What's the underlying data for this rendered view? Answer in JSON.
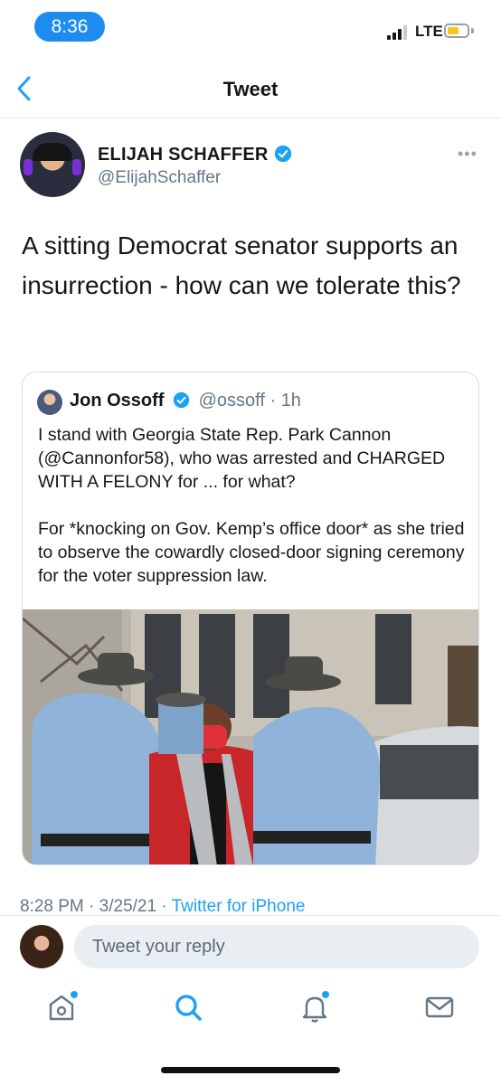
{
  "status_bar": {
    "time": "8:36",
    "network": "LTE",
    "battery_level": 0.6
  },
  "nav": {
    "title": "Tweet"
  },
  "tweet": {
    "author_name": "ELIJAH SCHAFFER",
    "author_handle": "@ElijahSchaffer",
    "more_icon": "ellipsis-icon",
    "text": "A sitting Democrat senator supports an insurrection - how can we tolerate this?"
  },
  "quoted_tweet": {
    "author_name": "Jon Ossoff",
    "author_handle": "@ossoff",
    "separator": "·",
    "time_ago": "1h",
    "text": "I stand with Georgia State Rep. Park Cannon (@Cannonfor58), who was arrested and CHARGED WITH A FELONY for ... for what?\n\nFor *knocking on Gov. Kemp’s office door* as she tried to observe the cowardly closed-door signing ceremony for the voter suppression law."
  },
  "meta": {
    "time": "8:28 PM",
    "separator": "·",
    "date": "3/25/21",
    "source": "Twitter for iPhone"
  },
  "reply": {
    "placeholder": "Tweet your reply"
  },
  "tabs": [
    {
      "name": "home-icon",
      "notification_dot": true
    },
    {
      "name": "search-icon",
      "active": true
    },
    {
      "name": "bell-icon",
      "notification_dot": true
    },
    {
      "name": "mail-icon"
    }
  ],
  "colors": {
    "accent": "#1da1f2",
    "secondary_text": "#657786",
    "time_pill": "#1d8cf0"
  }
}
